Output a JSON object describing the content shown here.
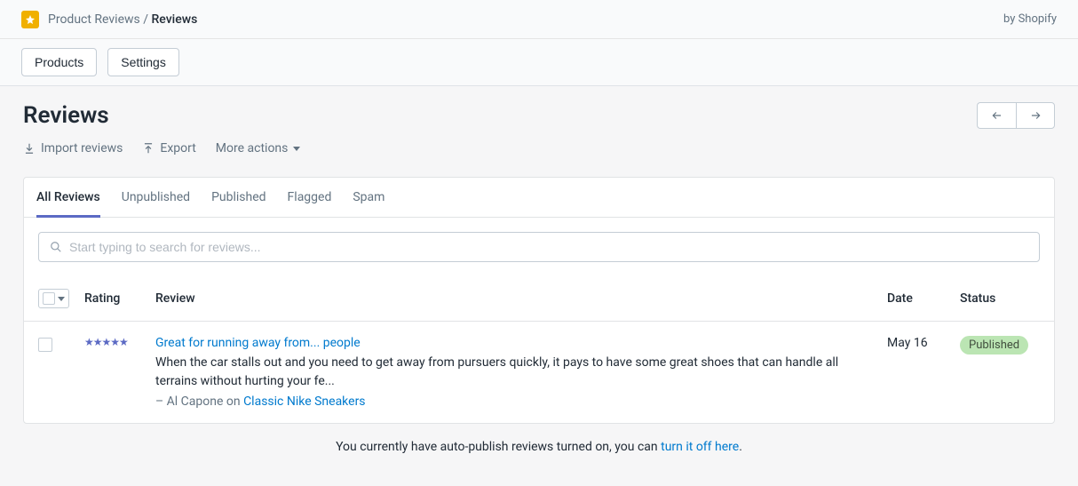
{
  "header": {
    "app_name": "Product Reviews",
    "crumb_current": "Reviews",
    "by_line": "by Shopify"
  },
  "nav": {
    "products": "Products",
    "settings": "Settings"
  },
  "page": {
    "title": "Reviews"
  },
  "actions": {
    "import": "Import reviews",
    "export": "Export",
    "more": "More actions"
  },
  "tabs": {
    "all": "All Reviews",
    "unpublished": "Unpublished",
    "published": "Published",
    "flagged": "Flagged",
    "spam": "Spam"
  },
  "search": {
    "placeholder": "Start typing to search for reviews..."
  },
  "columns": {
    "rating": "Rating",
    "review": "Review",
    "date": "Date",
    "status": "Status"
  },
  "reviews": [
    {
      "title": "Great for running away from... people",
      "body": "When the car stalls out and you need to get away from pursuers quickly, it pays to have some great shoes that can handle all terrains without hurting your fe...",
      "author_prefix": "– Al Capone on ",
      "product": "Classic Nike Sneakers",
      "rating": 5,
      "date": "May 16",
      "status": "Published"
    }
  ],
  "footer": {
    "text_before": "You currently have auto-publish reviews turned on, you can ",
    "link": "turn it off here",
    "period": "."
  }
}
